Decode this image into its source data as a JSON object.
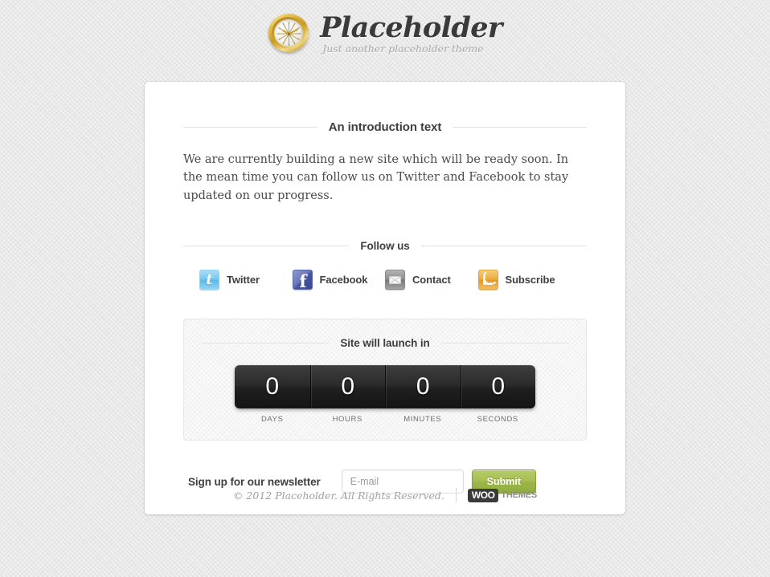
{
  "header": {
    "logo_icon": "clock-icon",
    "site_title": "Placeholder",
    "tagline": "Just another placeholder theme"
  },
  "intro": {
    "heading": "An introduction text",
    "body": "We are currently building a new site which will be ready soon. In the mean time you can follow us on Twitter and Facebook to stay updated on our progress."
  },
  "follow": {
    "heading": "Follow us",
    "items": [
      {
        "label": "Twitter",
        "icon": "twitter-icon"
      },
      {
        "label": "Facebook",
        "icon": "facebook-icon"
      },
      {
        "label": "Contact",
        "icon": "envelope-icon"
      },
      {
        "label": "Subscribe",
        "icon": "rss-icon"
      }
    ]
  },
  "countdown": {
    "heading": "Site will launch in",
    "segments": [
      {
        "value": "0",
        "label": "DAYS"
      },
      {
        "value": "0",
        "label": "HOURS"
      },
      {
        "value": "0",
        "label": "MINUTES"
      },
      {
        "value": "0",
        "label": "SECONDS"
      }
    ]
  },
  "newsletter": {
    "label": "Sign up for our newsletter",
    "email_value": "",
    "email_placeholder": "E-mail",
    "submit_label": "Submit"
  },
  "footer": {
    "copyright": "© 2012 Placeholder. All Rights Reserved.",
    "brand_badge": "WOO",
    "brand_name": "THEMES"
  },
  "colors": {
    "page_background": "#e9e9e9",
    "card_background": "#ffffff",
    "heading_text": "#3f3f3f",
    "body_text": "#4b4b4b",
    "muted_text": "#a0a0a0",
    "countdown_dark": "#2b2b2b",
    "submit_green": "#a6be52",
    "twitter_blue": "#74c7ee",
    "facebook_blue": "#44539c",
    "contact_gray": "#8d8d8d",
    "rss_orange": "#edab3c"
  }
}
